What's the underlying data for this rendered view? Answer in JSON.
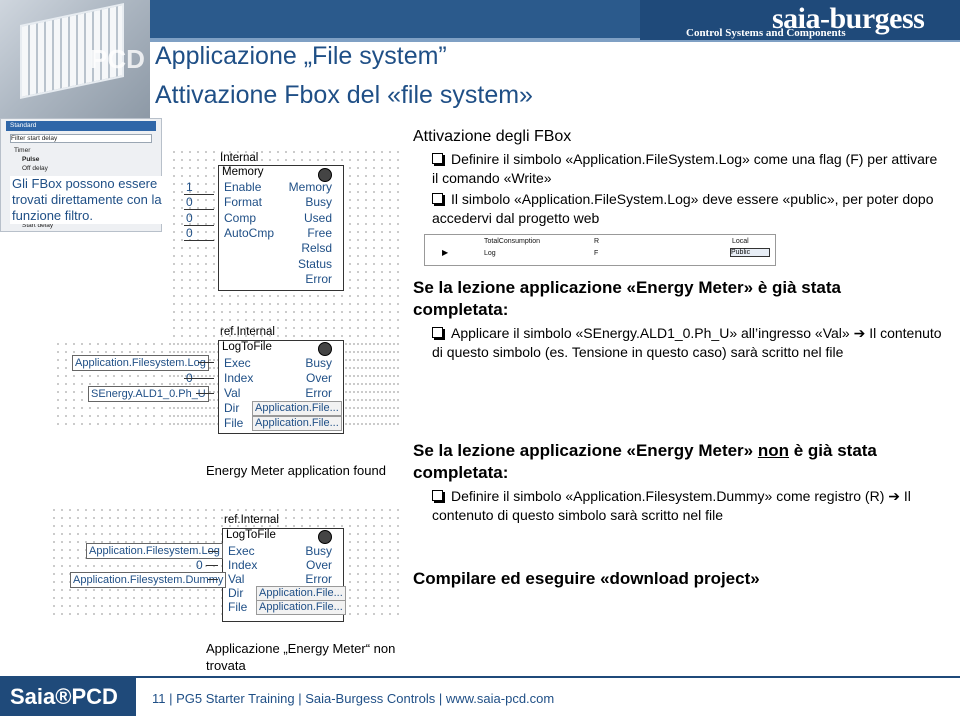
{
  "header": {
    "brand_name": "saia-burgess",
    "brand_sub": "Control Systems and Components",
    "photo_label": "PCD"
  },
  "titles": {
    "title1": "Applicazione „File system”",
    "title2": "Attivazione Fbox del «file system»"
  },
  "left_panel": {
    "rows": [
      "Standard",
      "Filter  start delay",
      "Timer",
      "Pulse",
      "Off delay",
      "Start delay"
    ],
    "note": "Gli FBox possono essere trovati direttamente con la funzione filtro."
  },
  "fbox_memory": {
    "header": "Internal",
    "title": "Memory",
    "inputs": [
      {
        "value": "1",
        "label": "Enable"
      },
      {
        "value": "0",
        "label": "Format"
      },
      {
        "value": "0",
        "label": "Comp"
      },
      {
        "value": "0",
        "label": "AutoCmp"
      }
    ],
    "outputs": [
      "Memory",
      "Busy",
      "Used",
      "Free",
      "Relsd",
      "Status",
      "Error"
    ]
  },
  "fbox_log1": {
    "header": "ref.Internal",
    "title": "LogToFile",
    "inputs": [
      {
        "value": "Application.Filesystem.Log",
        "label": "Exec"
      },
      {
        "value": "0",
        "label": "Index"
      },
      {
        "value": "SEnergy.ALD1_0.Ph_U",
        "label": "Val"
      },
      {
        "value": "",
        "label": "Dir"
      },
      {
        "value": "",
        "label": "File"
      }
    ],
    "outputs": [
      "Busy",
      "Over",
      "Error"
    ],
    "dir_value": "Application.File...",
    "file_value": "Application.File...",
    "caption": "Energy Meter application found"
  },
  "fbox_log2": {
    "header": "ref.Internal",
    "title": "LogToFile",
    "inputs": [
      {
        "value": "Application.Filesystem.Log",
        "label": "Exec"
      },
      {
        "value": "0",
        "label": "Index"
      },
      {
        "value": "Application.Filesystem.Dummy",
        "label": "Val"
      },
      {
        "value": "",
        "label": "Dir"
      },
      {
        "value": "",
        "label": "File"
      }
    ],
    "outputs": [
      "Busy",
      "Over",
      "Error"
    ],
    "dir_value": "Application.File...",
    "file_value": "Application.File...",
    "caption": "Applicazione „Energy Meter“ non trovata"
  },
  "right": {
    "head": "Attivazione degli FBox",
    "bullets1": [
      "Definire il simbolo «Application.FileSystem.Log» come una flag (F) per attivare il comando «Write»",
      "Il simbolo «Application.FileSystem.Log» deve essere «public», per poter dopo accedervi dal progetto web"
    ],
    "table": {
      "row1": [
        "TotalConsumption",
        "R",
        "Local"
      ],
      "row2": [
        "Log",
        "F",
        "Public"
      ]
    },
    "sec2_title": "Se la lezione applicazione «Energy Meter» è già stata completata:",
    "bullets2": [
      "Applicare il simbolo «SEnergy.ALD1_0.Ph_U» all’ingresso «Val» ➔ Il contenuto di questo simbolo (es. Tensione in questo caso) sarà scritto nel file"
    ],
    "sec3_title_a": "Se la lezione applicazione «Energy Meter» ",
    "sec3_title_u": "non",
    "sec3_title_b": " è già stata completata:",
    "bullets3": [
      "Definire il simbolo «Application.Filesystem.Dummy» come registro (R) ➔ Il contenuto di questo simbolo sarà scritto nel file"
    ],
    "sec4": "Compilare ed eseguire «download project»"
  },
  "footer": {
    "logo": "Saia®PCD",
    "text": "11  |  PG5 Starter Training  |  Saia-Burgess Controls  |  www.saia-pcd.com"
  }
}
